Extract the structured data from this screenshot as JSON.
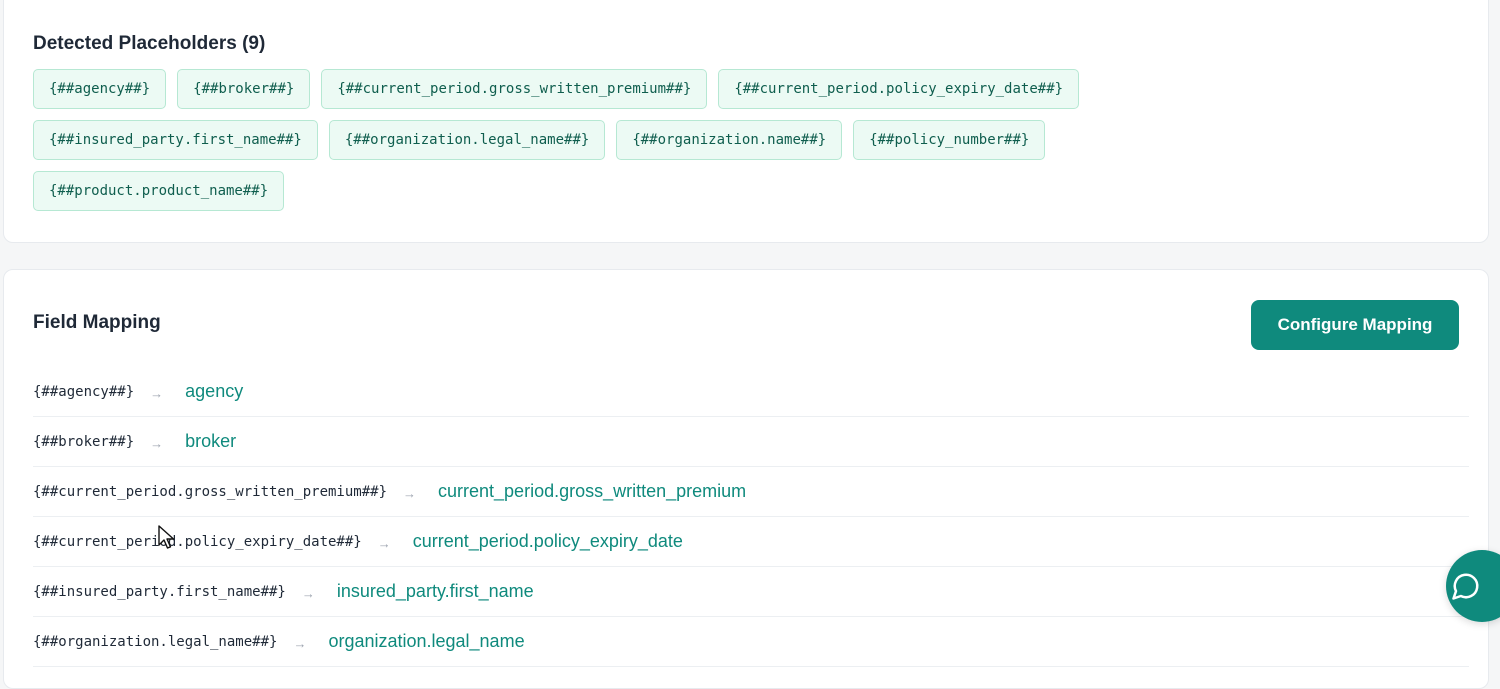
{
  "placeholders": {
    "title": "Detected Placeholders (9)",
    "chips": [
      "{##agency##}",
      "{##broker##}",
      "{##current_period.gross_written_premium##}",
      "{##current_period.policy_expiry_date##}",
      "{##insured_party.first_name##}",
      "{##organization.legal_name##}",
      "{##organization.name##}",
      "{##policy_number##}",
      "{##product.product_name##}"
    ]
  },
  "mapping": {
    "title": "Field Mapping",
    "configure_label": "Configure Mapping",
    "arrow": "→",
    "rows": [
      {
        "placeholder": "{##agency##}",
        "field": "agency"
      },
      {
        "placeholder": "{##broker##}",
        "field": "broker"
      },
      {
        "placeholder": "{##current_period.gross_written_premium##}",
        "field": "current_period.gross_written_premium"
      },
      {
        "placeholder": "{##current_period.policy_expiry_date##}",
        "field": "current_period.policy_expiry_date"
      },
      {
        "placeholder": "{##insured_party.first_name##}",
        "field": "insured_party.first_name"
      },
      {
        "placeholder": "{##organization.legal_name##}",
        "field": "organization.legal_name"
      }
    ]
  },
  "chat": {
    "icon": "chat-bubble-icon"
  },
  "colors": {
    "accent": "#0f8a7d",
    "chip_bg": "#ecfaf4",
    "chip_border": "#b6e8d3"
  }
}
